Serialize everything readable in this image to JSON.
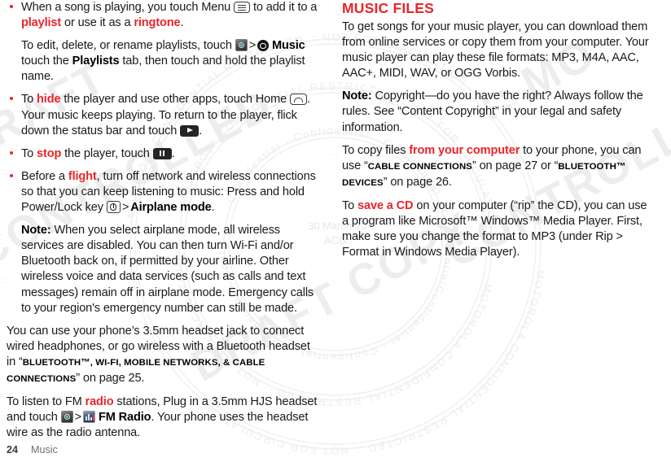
{
  "document": {
    "title": "Music",
    "page_number": "24",
    "footer_label": "Music"
  },
  "watermark": {
    "texts": [
      "MOTOROLA CONFIDENTIAL RESTRICTED :: NOT FOR CIRCULATION",
      "CONTROLLED DRAFT COPY",
      "30 March 20",
      "ACG",
      "Confidential"
    ],
    "color": "#ebebeb"
  },
  "colors": {
    "accent_red": "#e8262a",
    "body_text": "#1a1a1a",
    "footer_text": "#6f6f6f"
  },
  "left_column": {
    "bullet_1": {
      "part1": "When a song is playing, you touch Menu ",
      "icon": "menu-key-icon",
      "part2": " to add it to a ",
      "kw1": "playlist",
      "part3": " or use it as a ",
      "kw2": "ringtone",
      "part4": "."
    },
    "sub_1": {
      "part1": "To edit, delete, or rename playlists, touch ",
      "icon1": "apps-launcher-icon",
      "sep": ">",
      "icon2": "music-app-icon",
      "bold1": "Music",
      "part2": " touch the ",
      "bold2": "Playlists",
      "part3": " tab, then touch and hold the playlist name."
    },
    "bullet_2": {
      "part1": "To ",
      "kw1": "hide",
      "part2": " the player and use other apps, touch Home ",
      "icon1": "home-key-icon",
      "part3": ". Your music keeps playing. To return to the player, flick down the status bar and touch ",
      "icon2": "play-button-icon",
      "part4": "."
    },
    "bullet_3": {
      "part1": "To ",
      "kw1": "stop",
      "part2": " the player, touch ",
      "icon1": "pause-button-icon",
      "part3": "."
    },
    "bullet_4": {
      "part1": "Before a ",
      "kw1": "flight",
      "part2": ", turn off network and wireless connections so that you can keep listening to music: Press and hold Power/Lock key ",
      "icon1": "power-lock-key-icon",
      "sep": ">",
      "bold1": "Airplane mode",
      "part3": "."
    },
    "note_1": {
      "label": "Note:",
      "text": " When you select airplane mode, all wireless services are disabled. You can then turn Wi-Fi and/or Bluetooth back on, if permitted by your airline. Other wireless voice and data services (such as calls and text messages) remain off in airplane mode. Emergency calls to your region's emergency number can still be made."
    },
    "para_1": {
      "part1": "You can use your phone’s 3.5mm headset jack to connect wired headphones, or go wireless with a Bluetooth headset in “",
      "xref": "Bluetooth™, Wi-Fi, Mobile Networks, & Cable Connections",
      "part2": "” on page 25."
    },
    "para_2": {
      "part1": "To listen to FM ",
      "kw1": "radio",
      "part2": " stations, Plug in a 3.5mm HJS headset and touch ",
      "icon1": "apps-launcher-icon",
      "sep": ">",
      "icon2": "fm-radio-icon",
      "bold1": "FM Radio",
      "part3": ". Your phone uses the headset wire as the radio antenna."
    }
  },
  "right_column": {
    "heading": "Music files",
    "para_1": "To get songs for your music player, you can download them from online services or copy them from your computer. Your music player can play these file formats: MP3, M4A, AAC, AAC+, MIDI, WAV, or OGG Vorbis.",
    "note_1": {
      "label": "Note:",
      "text": " Copyright—do you have the right? Always follow the rules. See “Content Copyright” in your legal and safety information."
    },
    "para_2": {
      "part1": "To copy files ",
      "kw1": "from your computer",
      "part2": " to your phone, you can use “",
      "xref1": "Cable Connections",
      "part3": "” on page 27 or “",
      "xref2": "Bluetooth™ Devices",
      "part4": "” on page 26."
    },
    "para_3": {
      "part1": "To ",
      "kw1": "save a CD",
      "part2": " on your computer (“rip” the CD), you can use a program like Microsoft™ Windows™ Media Player. First, make sure you change the format to MP3 (under Rip > Format in Windows Media Player)."
    }
  }
}
